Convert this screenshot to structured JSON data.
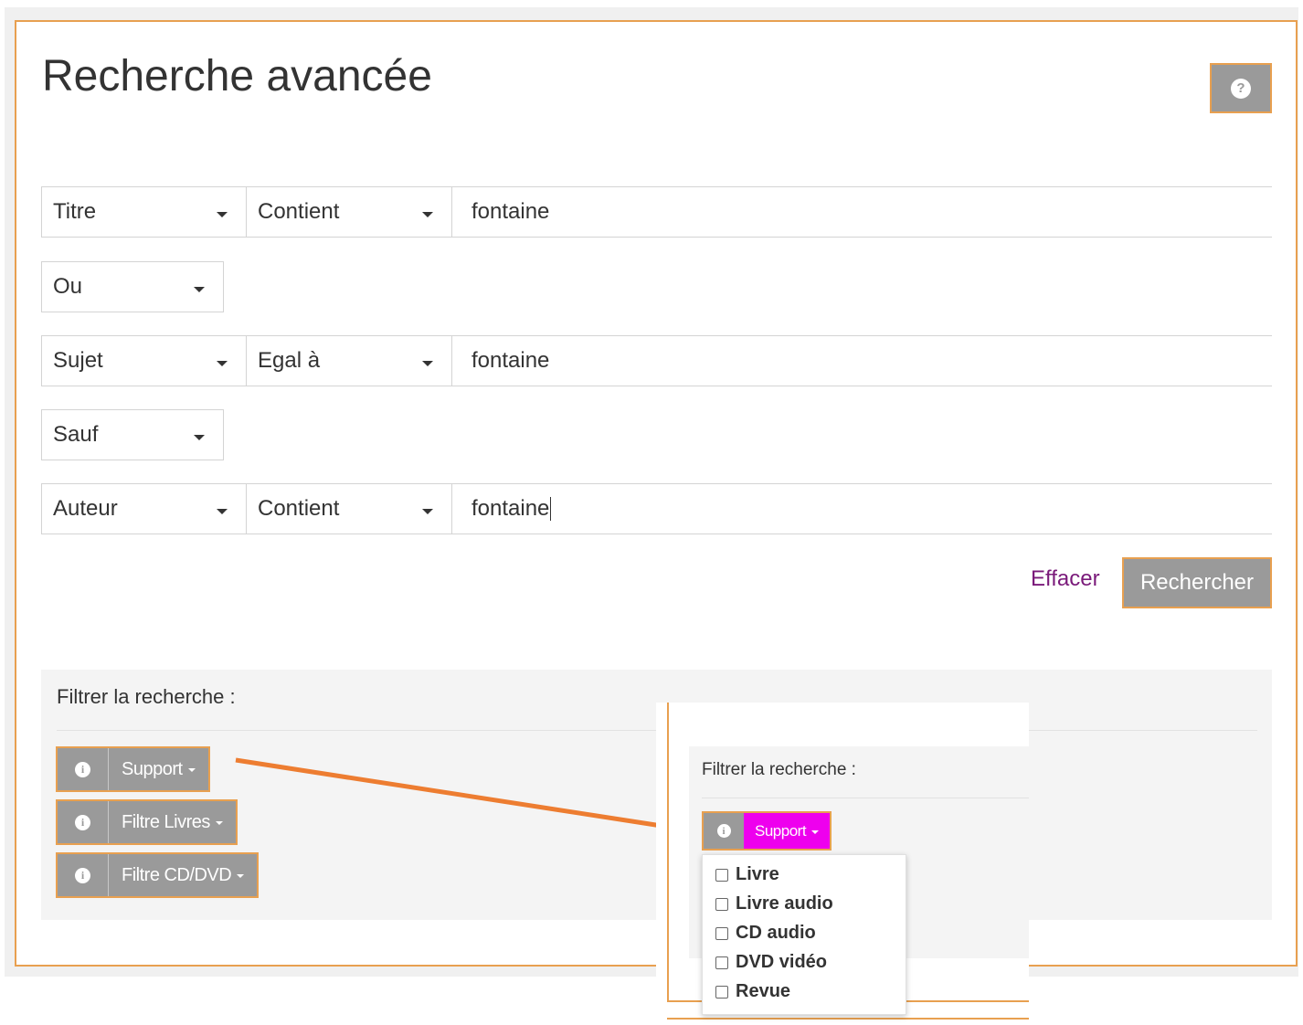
{
  "page": {
    "title": "Recherche avancée"
  },
  "rows": [
    {
      "field": "Titre",
      "operator": "Contient",
      "value": "fontaine"
    },
    {
      "field": "Sujet",
      "operator": "Egal à",
      "value": "fontaine"
    },
    {
      "field": "Auteur",
      "operator": "Contient",
      "value": "fontaine"
    }
  ],
  "connectors": [
    "Ou",
    "Sauf"
  ],
  "actions": {
    "clear_label": "Effacer",
    "search_label": "Rechercher"
  },
  "filter": {
    "title": "Filtrer la recherche :",
    "groups": [
      {
        "label": "Support"
      },
      {
        "label": "Filtre Livres"
      },
      {
        "label": "Filtre CD/DVD"
      }
    ]
  },
  "inset": {
    "title": "Filtrer la recherche :",
    "button_label": "Support",
    "options": [
      "Livre",
      "Livre audio",
      "CD audio",
      "DVD vidéo",
      "Revue"
    ]
  },
  "colors": {
    "accent_border": "#e8a050",
    "button_gray": "#9a9a9a",
    "highlight_magenta": "#ee00ee",
    "arrow_orange": "#ed7d31",
    "link_purple": "#7a1a7a"
  },
  "icons": {
    "help": "question-circle-icon",
    "info": "info-circle-icon",
    "caret": "caret-down-icon"
  }
}
